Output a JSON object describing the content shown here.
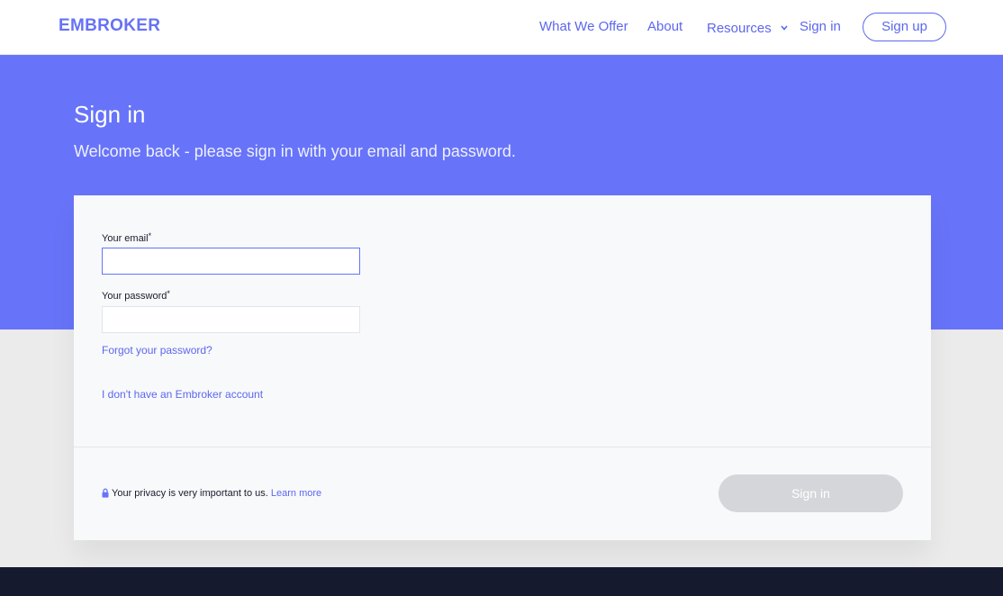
{
  "header": {
    "logo": "EMBROKER",
    "nav": {
      "what_we_offer": "What We Offer",
      "about": "About",
      "resources": "Resources",
      "sign_in": "Sign in"
    },
    "sign_up": "Sign up"
  },
  "hero": {
    "title": "Sign in",
    "subtitle": "Welcome back - please sign in with your email and password."
  },
  "form": {
    "email_label": "Your email",
    "password_label": "Your password",
    "required_mark": "*",
    "email_value": "",
    "password_value": "",
    "forgot_link": "Forgot your password?",
    "no_account_link": "I don't have an Embroker account",
    "privacy_text": "Your privacy is very important to us.",
    "learn_more": "Learn more",
    "submit": "Sign in"
  },
  "colors": {
    "brand": "#6774f9",
    "link": "#5c67ef",
    "disabled_button": "#d5d6d9",
    "footer": "#161a2e"
  },
  "icons": {
    "resources_dropdown": "chevron-down-icon",
    "privacy": "lock-icon"
  }
}
